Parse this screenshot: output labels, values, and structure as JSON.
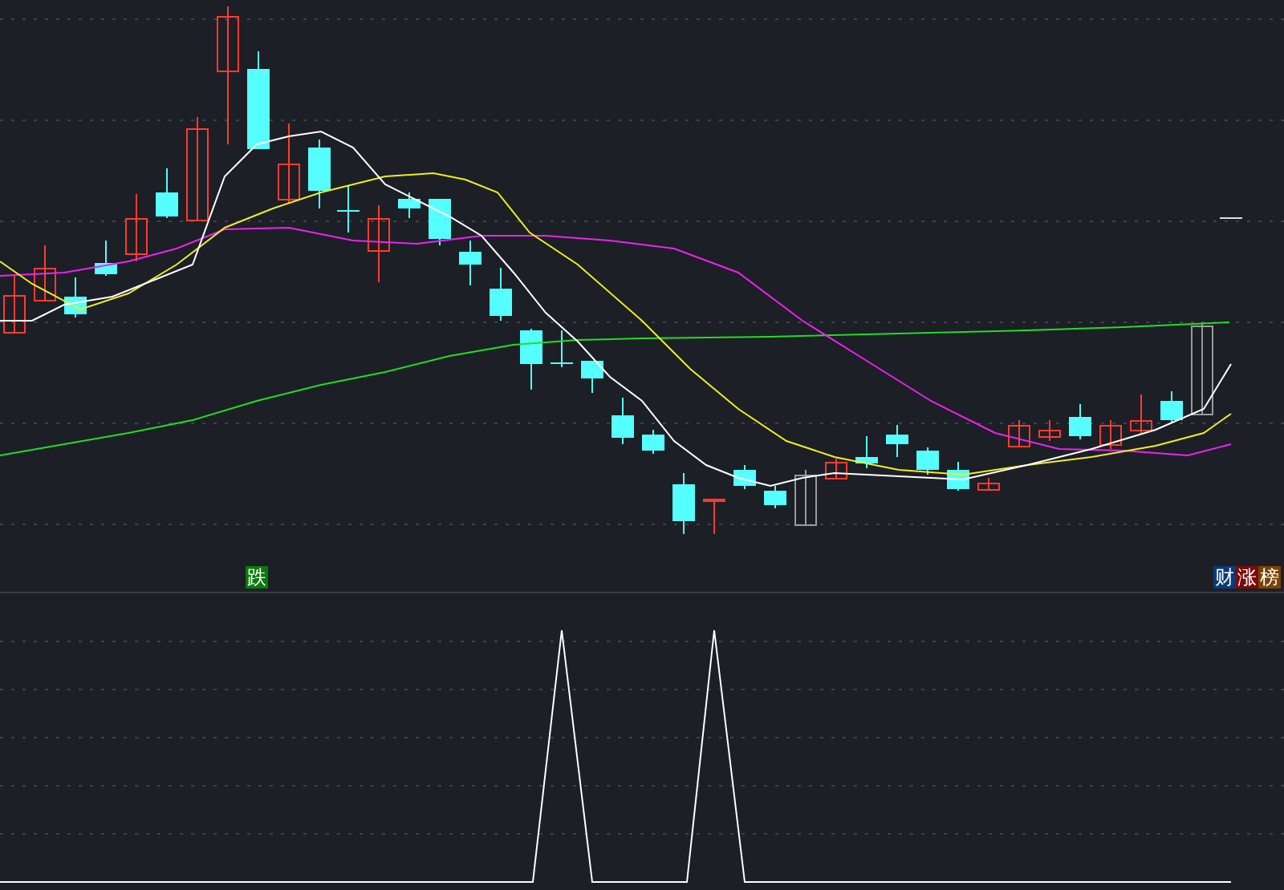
{
  "signal_label": {
    "text": "跌",
    "color": "#0a7a0a"
  },
  "tags": [
    {
      "text": "财",
      "color": "#0a3a78"
    },
    {
      "text": "涨",
      "color": "#7a0a0a"
    },
    {
      "text": "榜",
      "color": "#7a4200"
    }
  ]
}
